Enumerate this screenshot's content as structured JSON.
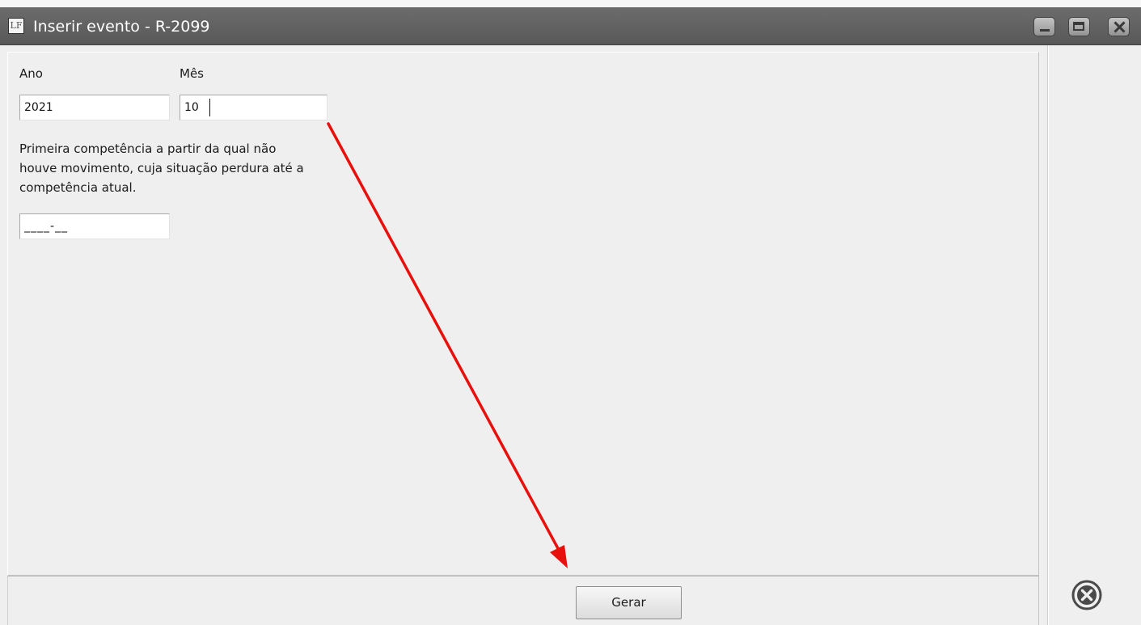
{
  "window": {
    "title": "Inserir evento - R-2099",
    "app_icon_text": "LF"
  },
  "form": {
    "ano_label": "Ano",
    "ano_value": "2021",
    "mes_label": "Mês",
    "mes_value": "10",
    "description": "Primeira competência a partir da qual não houve movimento, cuja situação perdura até a competência atual.",
    "competencia_mask": "____-__"
  },
  "footer": {
    "gerar_label": "Gerar"
  },
  "colors": {
    "titlebar": "#606060",
    "annotation_arrow": "#e8100c",
    "background": "#efefef"
  },
  "icons": {
    "cancel": "circle-x-icon"
  }
}
